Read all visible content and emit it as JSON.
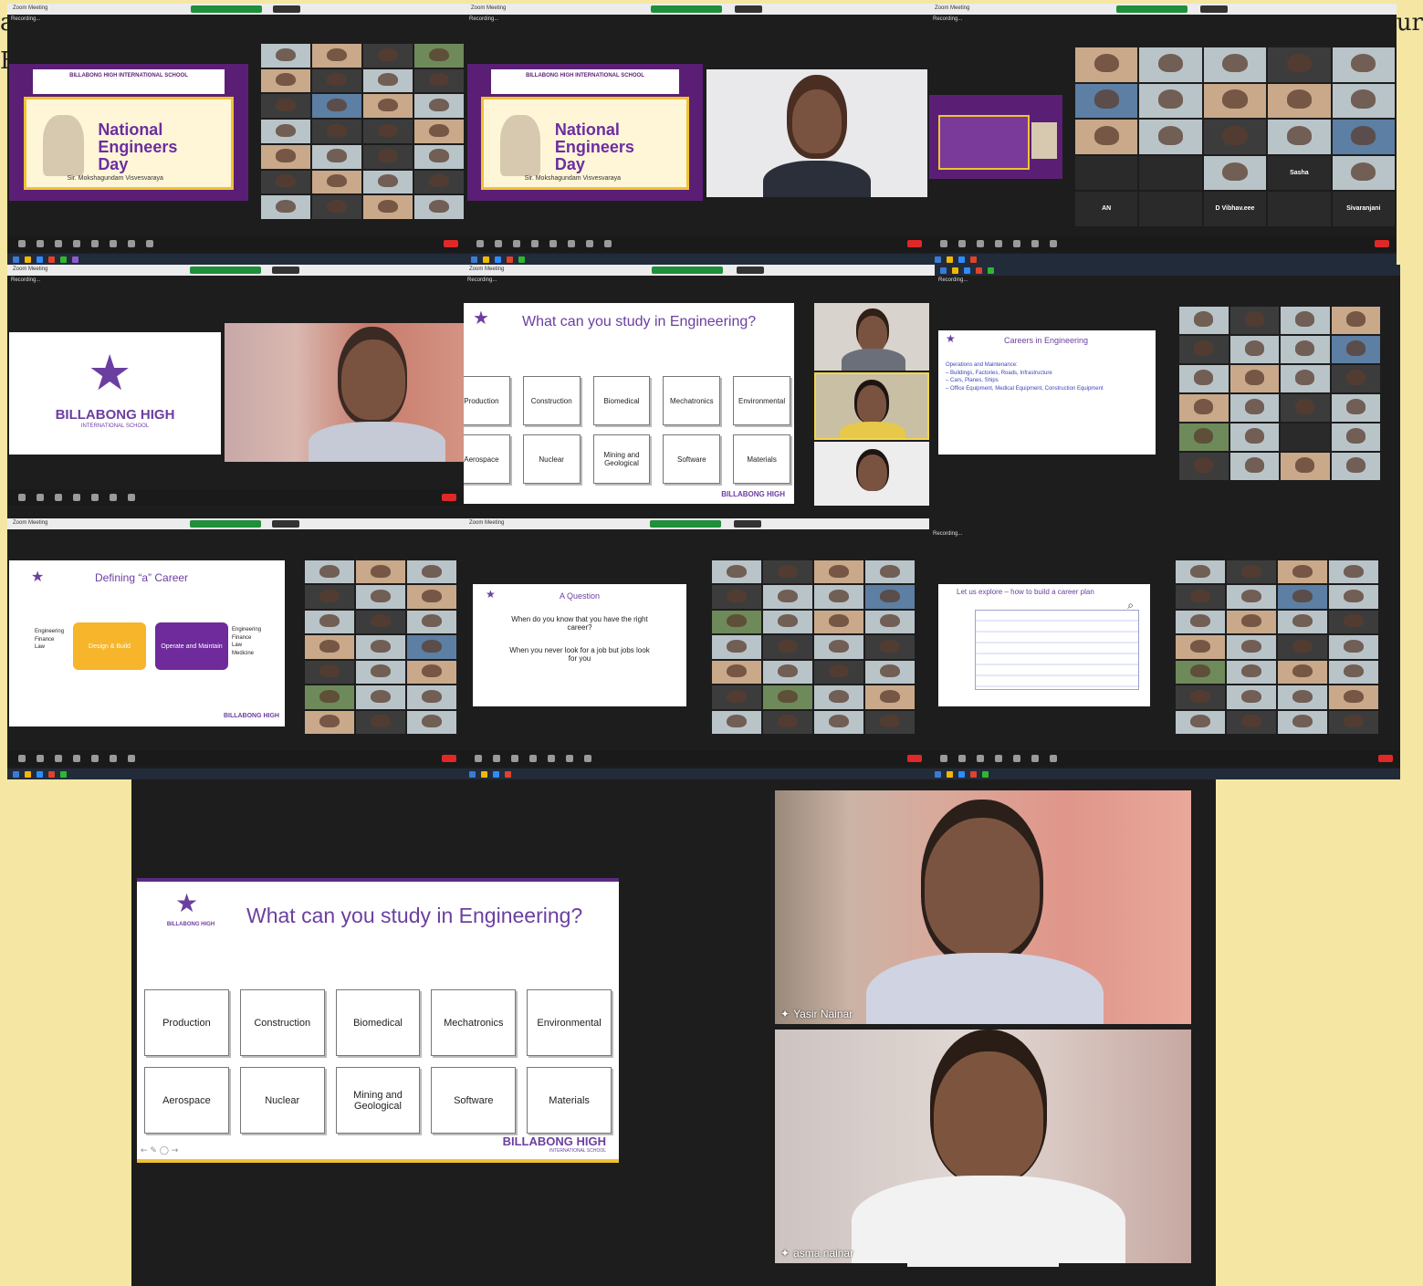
{
  "edge": {
    "left_top": "a",
    "right_top": "ur",
    "left_second": "F"
  },
  "zoom": {
    "window_title": "Zoom Meeting",
    "recording": "Recording...",
    "view_options": "View Options"
  },
  "engineering_slide": {
    "title": "What can you study in Engineering?",
    "boxes": [
      "Production",
      "Construction",
      "Biomedical",
      "Mechatronics",
      "Environmental",
      "Aerospace",
      "Nuclear",
      "Mining and Geological",
      "Software",
      "Materials"
    ],
    "brand": "BILLABONG HIGH",
    "brand_sub": "INTERNATIONAL SCHOOL"
  },
  "banner": {
    "school": "BILLABONG HIGH INTERNATIONAL SCHOOL",
    "title_lines": [
      "National",
      "Engineers",
      "Day"
    ],
    "caption": "Sir. Mokshagundam Visvesvaraya"
  },
  "billabong_logo": {
    "name": "BILLABONG HIGH",
    "sub": "INTERNATIONAL SCHOOL"
  },
  "careers": {
    "title": "Careers in Engineering",
    "lines": [
      "Operations and Maintenance:",
      "– Buildings, Factories, Roads, Infrastructure",
      "– Cars, Planes, Ships",
      "– Office Equipment, Medical Equipment, Construction Equipment"
    ]
  },
  "defining": {
    "title": "Defining “a” Career",
    "left_list": [
      "Engineering",
      "Finance",
      "Law"
    ],
    "box1": "Design & Build",
    "box2": "Operate and Maintain",
    "right_list": [
      "Engineering",
      "Finance",
      "Law",
      "Medicine"
    ]
  },
  "question": {
    "title": "A Question",
    "q": "When do you know that you have the right career?",
    "a": "When you never look for a job but jobs look for you"
  },
  "explore": {
    "title": "Let us explore – how to build a career plan"
  },
  "tile_labels": [
    "Sasha",
    "D Vibhav.eee",
    "AN",
    "Sivaranjani"
  ],
  "speakers": [
    {
      "name": "Yasir Nainar"
    },
    {
      "name": "asma nainar"
    }
  ],
  "colors": {
    "purple": "#6b3fa0",
    "yellow_bg": "#f5e6a3",
    "zoom_dark": "#1d1d1d",
    "end_red": "#e02828"
  }
}
